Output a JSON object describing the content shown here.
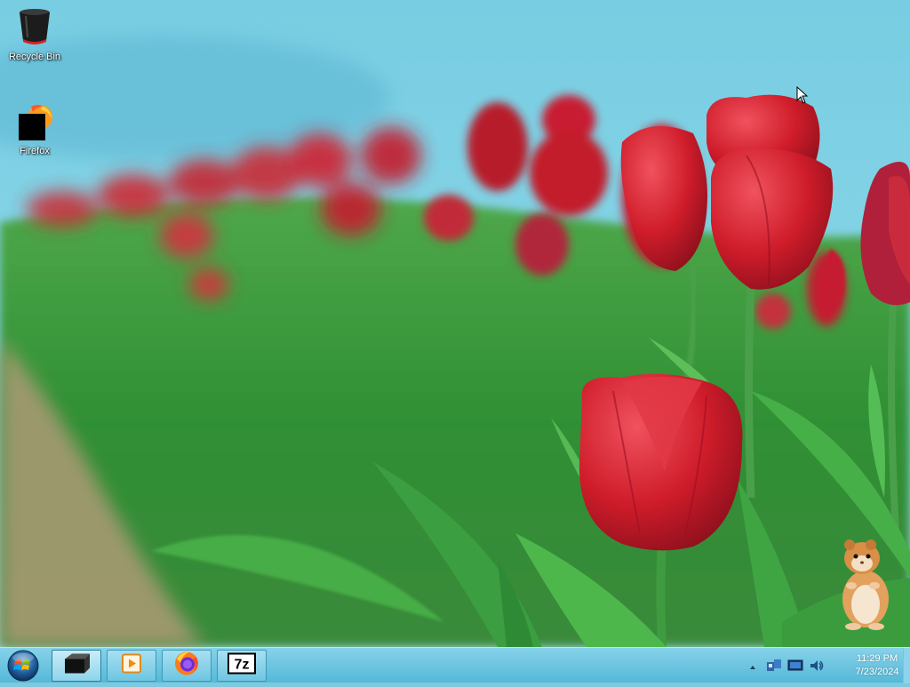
{
  "desktop": {
    "icons": [
      {
        "label": "Recycle Bin",
        "icon": "recycle-bin-icon"
      },
      {
        "label": "Firefox",
        "icon": "firefox-icon"
      }
    ],
    "wallpaper": "red-tulips-field"
  },
  "taskbar": {
    "start": {
      "icon": "windows-start-orb-icon"
    },
    "buttons": [
      {
        "icon": "terminal-box-icon",
        "active": true
      },
      {
        "icon": "media-player-icon",
        "active": false
      },
      {
        "icon": "firefox-icon",
        "active": false
      },
      {
        "icon": "7zip-icon",
        "label": "7z",
        "active": false
      }
    ],
    "tray": {
      "icons": [
        "show-hidden-icons-chevron",
        "network-icon",
        "display-icon",
        "volume-icon"
      ],
      "time": "11:29 PM",
      "date": "7/23/2024"
    }
  },
  "colors": {
    "taskbar": "#6fc6e2",
    "sky": "#7ec9dd",
    "tulip_red": "#d4202c",
    "leaf_green": "#3da33c"
  }
}
